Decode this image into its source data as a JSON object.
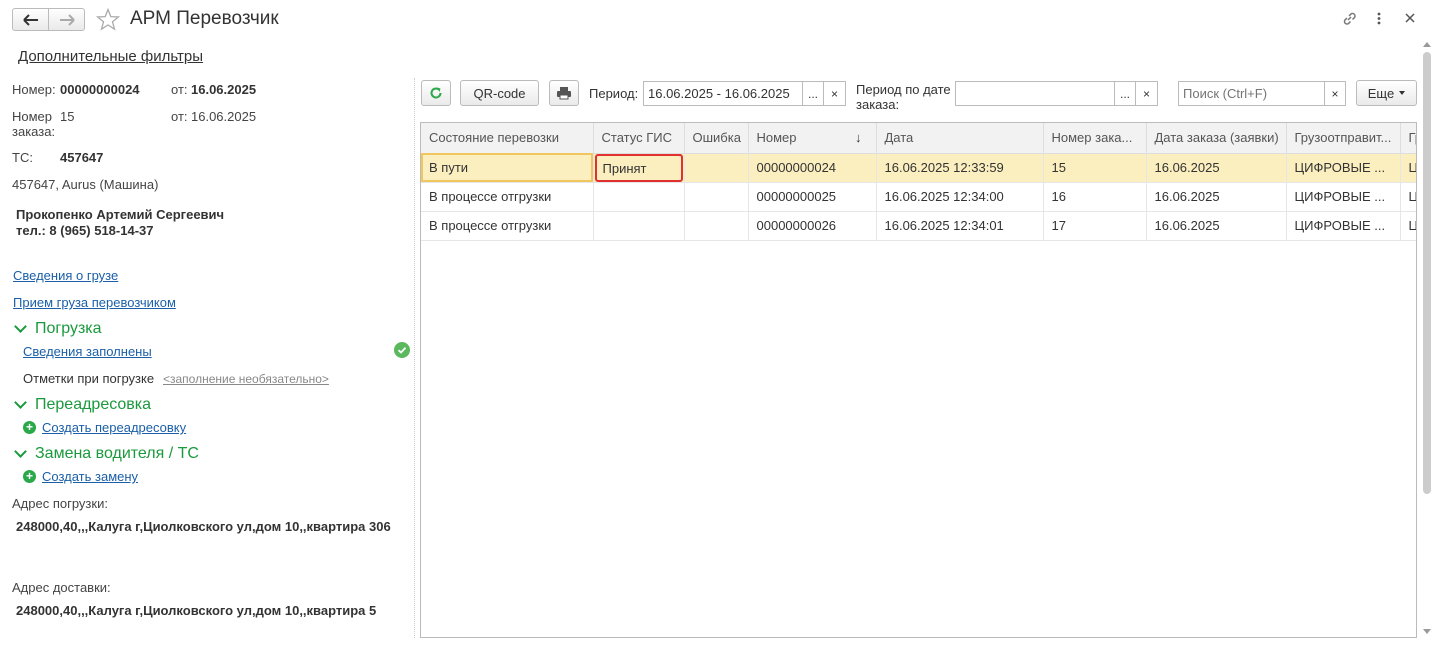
{
  "window": {
    "title": "АРМ Перевозчик"
  },
  "filters_link": "Дополнительные фильтры",
  "info": {
    "number_label": "Номер:",
    "number_value": "00000000024",
    "from_label1": "от:",
    "from_value1": "16.06.2025",
    "order_label_line1": "Номер",
    "order_label_line2": "заказа:",
    "order_value": "15",
    "from_label2": "от:",
    "from_value2": "16.06.2025",
    "ts_label": "ТС:",
    "ts_value": "457647",
    "vehicle": "457647, Aurus (Машина)",
    "driver_name": "Прокопенко Артемий Сергеевич",
    "driver_phone": "тел.: 8 (965) 518-14-37"
  },
  "links": {
    "cargo_info": "Сведения о грузе",
    "cargo_accept": "Прием груза перевозчиком"
  },
  "loading": {
    "title": "Погрузка",
    "filled_link": "Сведения заполнены",
    "marks_label": "Отметки при погрузке",
    "marks_optional": "<заполнение необязательно>"
  },
  "redirect": {
    "title": "Переадресовка",
    "create": "Создать переадресовку"
  },
  "replace": {
    "title": "Замена водителя / ТС",
    "create": "Создать замену"
  },
  "addresses": {
    "loading_label": "Адрес погрузки:",
    "loading_value": "248000,40,,,Калуга г,Циолковского ул,дом 10,,квартира 306",
    "delivery_label": "Адрес доставки:",
    "delivery_value": "248000,40,,,Калуга г,Циолковского ул,дом 10,,квартира 5"
  },
  "toolbar": {
    "qr": "QR-code",
    "period_label": "Период:",
    "period_value": "16.06.2025 - 16.06.2025",
    "period_order_line1": "Период по дате",
    "period_order_line2": "заказа:",
    "period_order_value": "",
    "dots": "...",
    "clear": "×",
    "search_placeholder": "Поиск (Ctrl+F)",
    "more": "Еще"
  },
  "table": {
    "columns": [
      "Состояние перевозки",
      "Статус ГИС",
      "Ошибка",
      "Номер",
      "Дата",
      "Номер зака...",
      "Дата заказа (заявки)",
      "Грузоотправит...",
      "Гр"
    ],
    "sort_arrow": "↓",
    "rows": [
      [
        "В пути",
        "Принят",
        "",
        "00000000024",
        "16.06.2025 12:33:59",
        "15",
        "16.06.2025",
        "ЦИФРОВЫЕ ...",
        "Ц"
      ],
      [
        "В процессе отгрузки",
        "",
        "",
        "00000000025",
        "16.06.2025 12:34:00",
        "16",
        "16.06.2025",
        "ЦИФРОВЫЕ ...",
        "Ц"
      ],
      [
        "В процессе отгрузки",
        "",
        "",
        "00000000026",
        "16.06.2025 12:34:01",
        "17",
        "16.06.2025",
        "ЦИФРОВЫЕ ...",
        "Ц"
      ]
    ]
  },
  "colors": {
    "accent_green": "#1a9a3c",
    "link_blue": "#1a5fa8",
    "selected_row": "#fbefc0",
    "highlight_red": "#e03030"
  }
}
